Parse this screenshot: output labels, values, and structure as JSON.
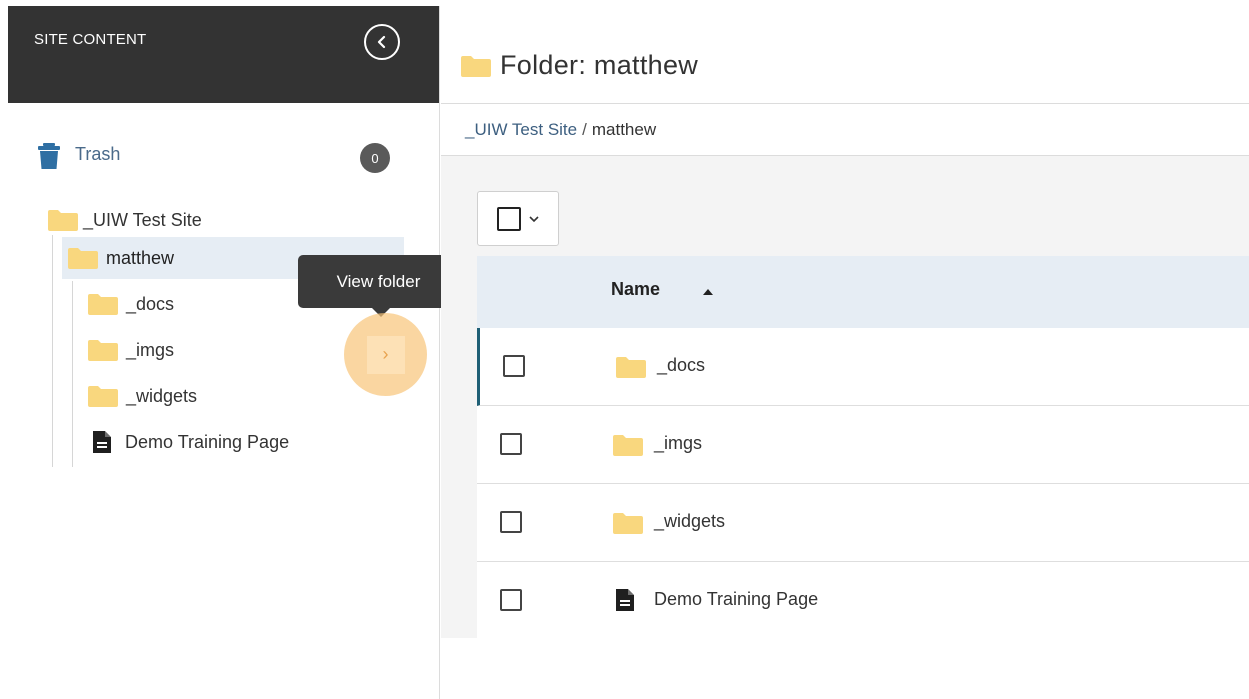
{
  "sidebar": {
    "title": "SITE CONTENT",
    "trash": {
      "label": "Trash",
      "count": "0"
    },
    "tree": {
      "root": "_UIW Test Site",
      "selected": "matthew",
      "children": [
        "_docs",
        "_imgs",
        "_widgets",
        "Demo Training Page"
      ]
    },
    "tooltip": "View folder",
    "view_button_glyph": "›"
  },
  "main": {
    "title": "Folder: matthew",
    "breadcrumb": {
      "root": "_UIW Test Site",
      "separator": "/",
      "current": "matthew"
    },
    "table": {
      "header_name": "Name",
      "rows": [
        {
          "name": "_docs",
          "type": "folder"
        },
        {
          "name": "_imgs",
          "type": "folder"
        },
        {
          "name": "_widgets",
          "type": "folder"
        },
        {
          "name": "Demo Training Page",
          "type": "page"
        }
      ]
    }
  },
  "colors": {
    "header_bg": "#333333",
    "folder": "#f9d77e",
    "selection_bg": "#e6edf4",
    "link": "#3d5f80",
    "highlight": "#f8c479"
  },
  "icons": {
    "collapse": "chevron-left-circle-icon",
    "trash": "trash-icon",
    "folder": "folder-icon",
    "page": "document-icon",
    "sort": "sort-ascending-icon",
    "dropdown": "chevron-down-icon"
  }
}
